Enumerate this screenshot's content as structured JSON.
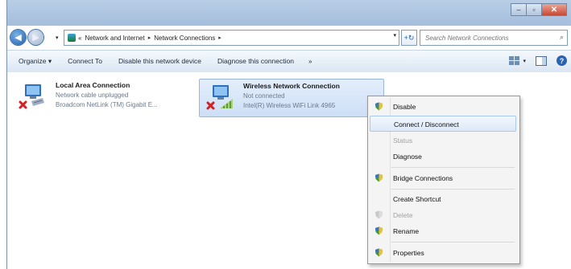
{
  "window": {
    "caption": {
      "minimize": "–",
      "maximize": "▫",
      "close": "✕"
    }
  },
  "nav": {
    "back": "◀",
    "forward": "▶",
    "dropdown": "▾",
    "breadcrumb": [
      "«",
      "Network and Internet",
      "▸",
      "Network Connections",
      "▸"
    ],
    "refresh": "+↻",
    "search_placeholder": "Search Network Connections",
    "search_icon": "⌕",
    "address_dropdown": "▾"
  },
  "toolbar": {
    "organize": "Organize ▾",
    "connect_to": "Connect To",
    "disable": "Disable this network device",
    "diagnose": "Diagnose this connection",
    "more": "»",
    "view_dropdown": "▾",
    "help": "?"
  },
  "connections": [
    {
      "name": "Local Area Connection",
      "status": "Network cable unplugged",
      "device": "Broadcom NetLink (TM) Gigabit E...",
      "icon": "wired-adapter-disconnected-icon"
    },
    {
      "name": "Wireless Network Connection",
      "status": "Not connected",
      "device": "Intel(R) Wireless WiFi Link 4965",
      "icon": "wireless-adapter-disconnected-icon"
    }
  ],
  "context_menu": {
    "items": [
      {
        "label": "Disable",
        "icon": "shield-icon",
        "enabled": true
      },
      {
        "label": "Connect / Disconnect",
        "enabled": true,
        "highlighted": true
      },
      {
        "label": "Status",
        "enabled": false
      },
      {
        "label": "Diagnose",
        "enabled": true
      },
      {
        "label": "Bridge Connections",
        "icon": "shield-icon",
        "enabled": true
      },
      {
        "label": "Create Shortcut",
        "enabled": true
      },
      {
        "label": "Delete",
        "icon": "shield-icon",
        "enabled": false
      },
      {
        "label": "Rename",
        "icon": "shield-icon",
        "enabled": true
      },
      {
        "label": "Properties",
        "icon": "shield-icon",
        "enabled": true
      }
    ]
  },
  "colors": {
    "titlebar": "#aec5e1",
    "toolbar": "#dbe6f3",
    "selection": "#cddff6",
    "menu_highlight": "#dde9f8",
    "error_x": "#d42020",
    "shield_green": "#3a9a3a"
  }
}
